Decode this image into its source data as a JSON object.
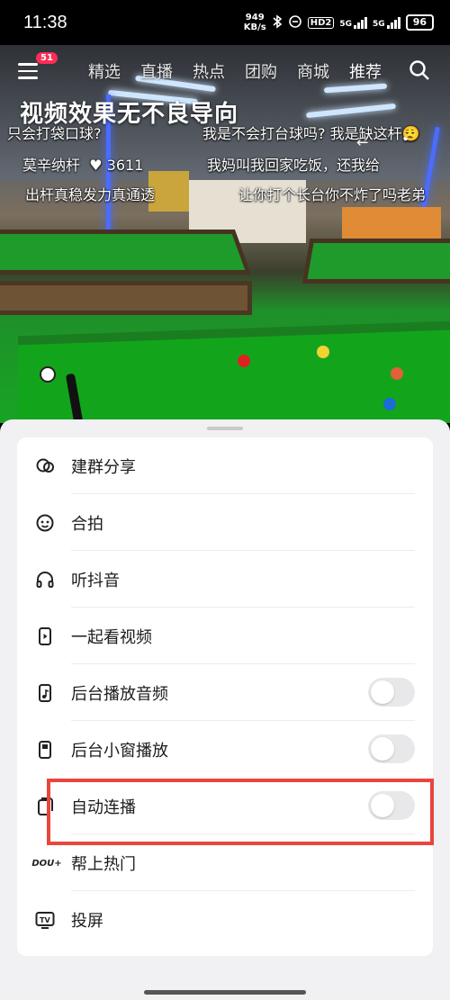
{
  "status_bar": {
    "time": "11:38",
    "net_speed": "949",
    "net_unit": "KB/s",
    "hd_label": "HD2",
    "sim1": "5G",
    "sim2": "5G",
    "battery": "96"
  },
  "top_nav": {
    "notification_count": "51",
    "tabs": [
      "精选",
      "直播",
      "热点",
      "团购",
      "商城",
      "推荐"
    ],
    "video_title": "视频效果无不良导向"
  },
  "danmu": [
    "只会打袋口球?",
    "我是不会打台球吗? 我是缺这杆😮‍💨",
    "莫辛纳杆",
    "3611",
    "我妈叫我回家吃饭，还我给",
    "出杆真稳发力真通透",
    "让你打个长台你不炸了吗老弟"
  ],
  "sheet": {
    "items": [
      {
        "label": "建群分享",
        "icon": "group-chat-icon",
        "toggle": null
      },
      {
        "label": "合拍",
        "icon": "duet-icon",
        "toggle": null
      },
      {
        "label": "听抖音",
        "icon": "headphones-icon",
        "toggle": null
      },
      {
        "label": "一起看视频",
        "icon": "watch-together-icon",
        "toggle": null
      },
      {
        "label": "后台播放音频",
        "icon": "background-audio-icon",
        "toggle": false
      },
      {
        "label": "后台小窗播放",
        "icon": "pip-icon",
        "toggle": false
      },
      {
        "label": "自动连播",
        "icon": "autoplay-icon",
        "toggle": false
      },
      {
        "label": "帮上热门",
        "icon": "dou-plus-icon",
        "toggle": null
      },
      {
        "label": "投屏",
        "icon": "cast-tv-icon",
        "toggle": null
      }
    ],
    "dou_logo": "DOU+"
  },
  "colors": {
    "highlight": "#e8453c",
    "badge": "#fe2c55",
    "toggle_off": "#e8e8ea"
  }
}
